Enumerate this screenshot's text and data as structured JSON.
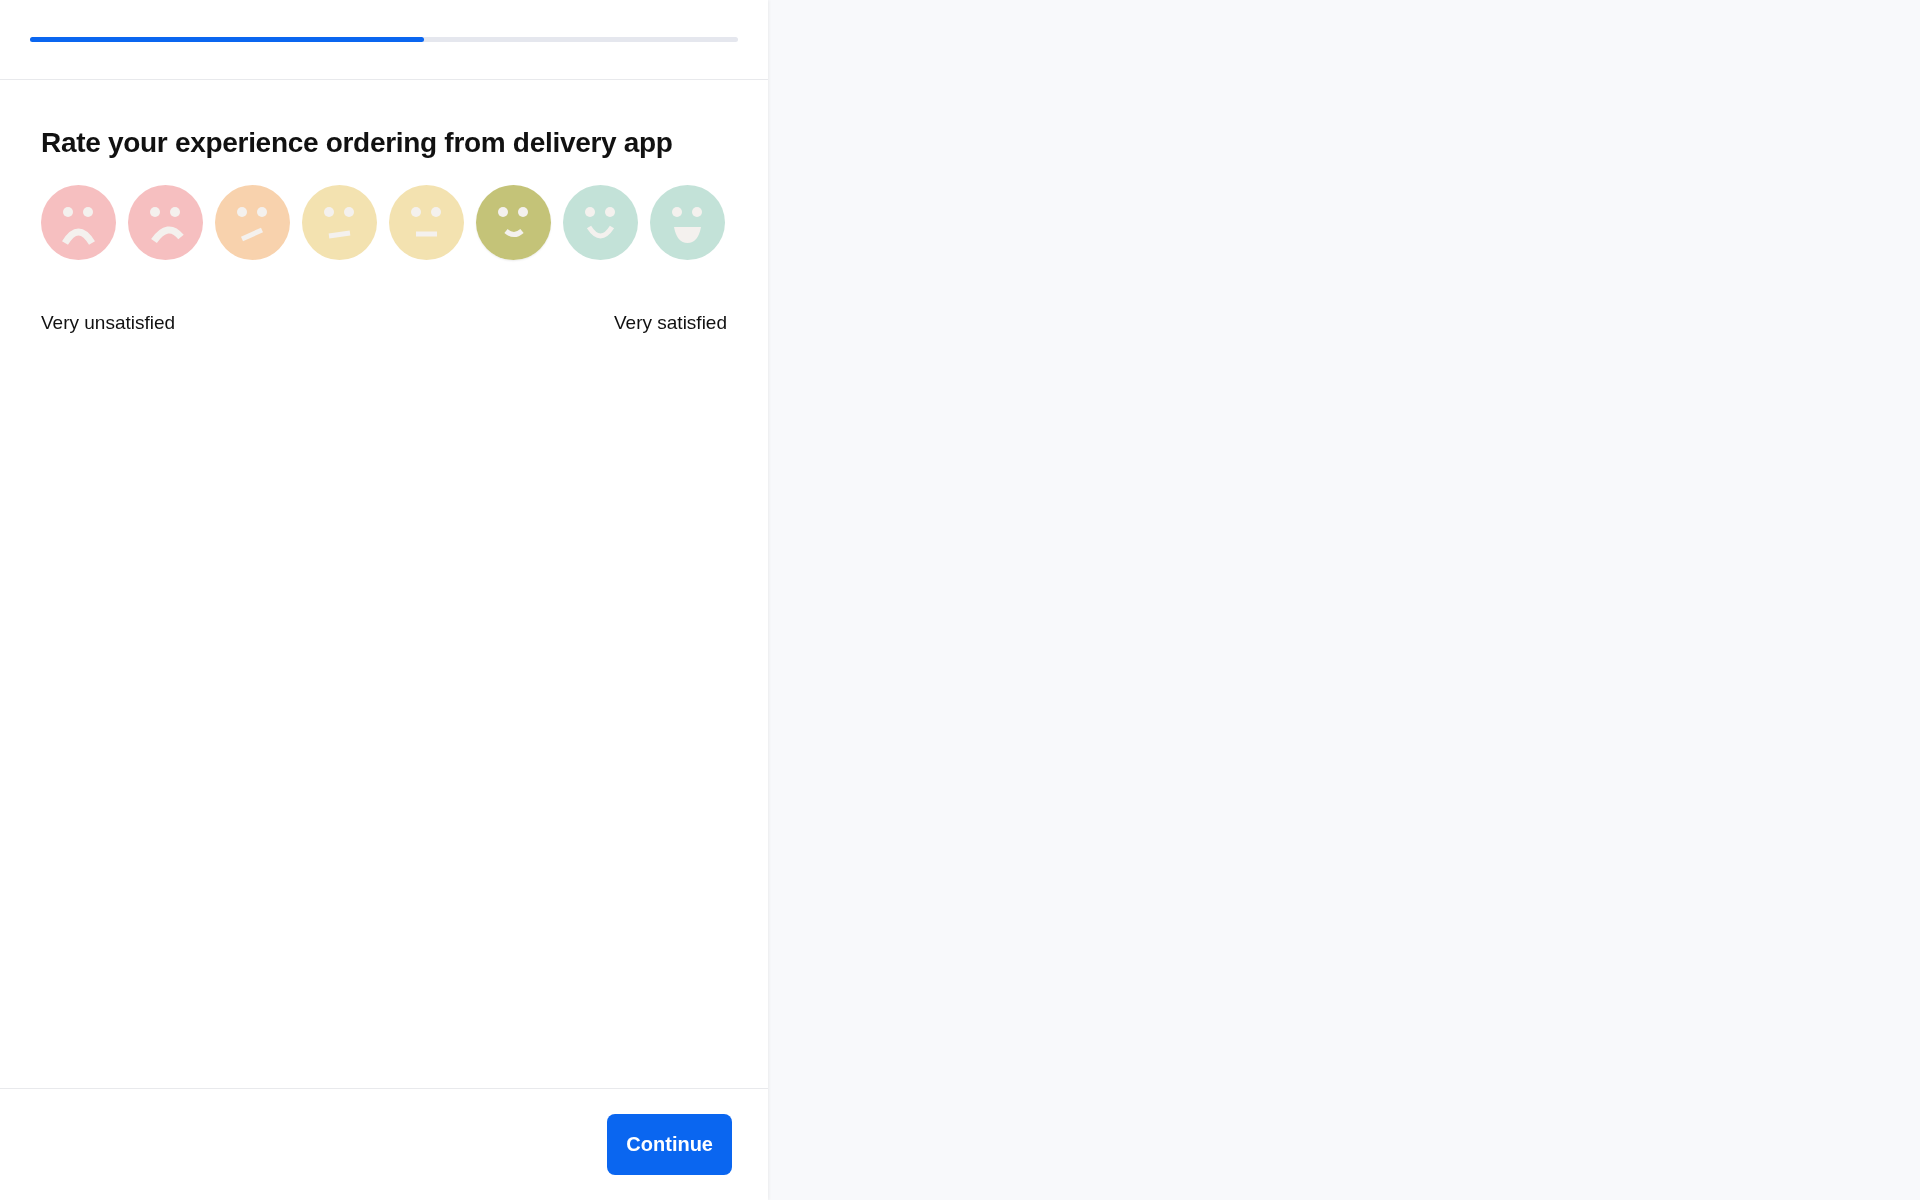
{
  "progress": {
    "level": 0.556
  },
  "question": {
    "title": "Rate your experience ordering from delivery app",
    "options": [
      {
        "kind": "very-sad",
        "color": "#f6bfc0",
        "selected": false
      },
      {
        "kind": "sad",
        "color": "#f6bfc0",
        "selected": false
      },
      {
        "kind": "slanted",
        "color": "#f8d2ad",
        "selected": false
      },
      {
        "kind": "slight",
        "color": "#f3e2b0",
        "selected": false
      },
      {
        "kind": "neutral",
        "color": "#f3e2b0",
        "selected": false
      },
      {
        "kind": "small-smile",
        "color": "#c4c378",
        "selected": true
      },
      {
        "kind": "smile",
        "color": "#c3e2d8",
        "selected": false
      },
      {
        "kind": "grin",
        "color": "#c3e2d8",
        "selected": false
      }
    ],
    "low_label": "Very unsatisfied",
    "high_label": "Very satisfied"
  },
  "footer": {
    "button": "Continue"
  }
}
